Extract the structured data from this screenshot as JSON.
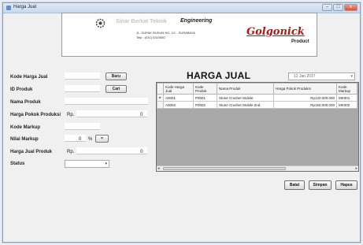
{
  "window": {
    "title": "Harga Jual",
    "controls": {
      "minimize": "–",
      "maximize": "□",
      "close": "x"
    }
  },
  "header": {
    "company_name": "Sinar Berkat Teknik",
    "tagline": "Engineering",
    "address_line1": "JL. DUPAK RUKUN NO. 1/1 - SURABAYA",
    "address_line2": "Telp : (031) 5310080",
    "brand": "Golgonick",
    "brand_sub": "Product"
  },
  "form": {
    "labels": {
      "kode_harga_jual": "Kode Harga Jual",
      "id_produk": "ID Produk",
      "nama_produk": "Nama Produk",
      "harga_pokok_produksi": "Harga Pokok Produksi",
      "kode_markup": "Kode Markup",
      "nilai_markup": "Nilai Markup",
      "harga_jual_produk": "Harga Jual Produk",
      "status": "Status"
    },
    "buttons": {
      "baru": "Baru",
      "cari": "Cari",
      "calc": "="
    },
    "currency_prefix": "Rp.",
    "harga_pokok_value": "0",
    "nilai_markup_value": "0",
    "percent": "%",
    "harga_jual_value": "0"
  },
  "main": {
    "title": "HARGA JUAL",
    "date": "12 Jan 2017"
  },
  "table": {
    "columns": [
      "Kode Harga Jual",
      "Kode Produk",
      "Nama Produk",
      "Harga Pokok Produksi",
      "Kode Markup"
    ],
    "rows": [
      [
        "A0001",
        "P0001",
        "Stone Crusher Mobile",
        "Rp120.000.000",
        "MK001"
      ],
      [
        "A0002",
        "P0002",
        "Stone Crusher Mobile 2nd",
        "Rp150.000.000",
        "MK002"
      ]
    ],
    "current_row_marker": "▸",
    "scroll_left": "◂",
    "scroll_right": "▸"
  },
  "actions": {
    "batal": "Batal",
    "simpan": "Simpan",
    "hapus": "Hapus"
  }
}
